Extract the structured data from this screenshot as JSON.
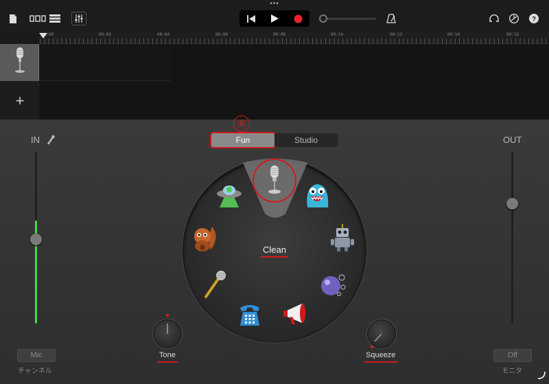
{
  "toolbar": {
    "more_dots": "•••",
    "left_icons": [
      "document-icon",
      "track-view-icon",
      "tracks-list-icon",
      "mixer-icon"
    ],
    "transport": {
      "rewind": "rewind-icon",
      "play": "play-icon",
      "record": "record-icon"
    },
    "right_icons": [
      "metronome-icon",
      "loop-icon",
      "settings-icon",
      "help-icon"
    ]
  },
  "ruler": {
    "labels": [
      "00:00",
      "00:02",
      "00:04",
      "00:06",
      "00:08",
      "00:10",
      "00:12",
      "00:14",
      "00:16"
    ]
  },
  "tracks": {
    "add_label": "+"
  },
  "mode": {
    "callout": "①",
    "tabs": [
      "Fun",
      "Studio"
    ],
    "selected": "Fun"
  },
  "input": {
    "label": "IN",
    "level_fraction": 0.6,
    "button": "Mic",
    "caption": "チャンネル"
  },
  "output": {
    "label": "OUT",
    "button": "Off",
    "caption": "モニタ"
  },
  "voices": {
    "selected_name": "Clean",
    "items": [
      "microphone",
      "alien-ufo",
      "monster",
      "chipmunk",
      "robot",
      "karaoke-mic",
      "bubbles",
      "telephone",
      "megaphone"
    ]
  },
  "knobs": {
    "tone_label": "Tone",
    "squeeze_label": "Squeeze"
  },
  "colors": {
    "accent_red": "#d31a1a",
    "level_green": "#4bd34b"
  }
}
